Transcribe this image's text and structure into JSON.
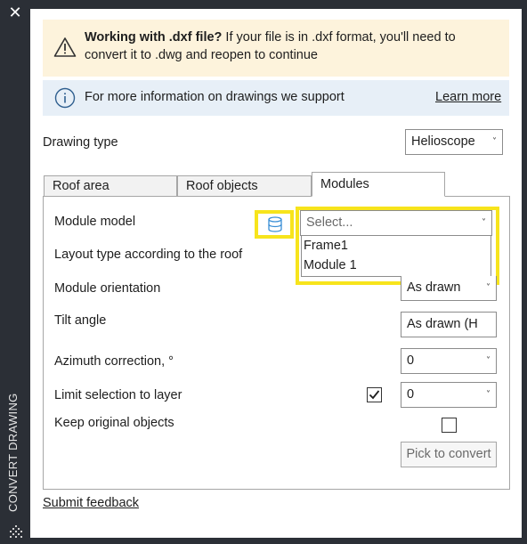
{
  "sidebar": {
    "title": "CONVERT DRAWING",
    "close_icon": "close-icon",
    "grip_icon": "grip-icon"
  },
  "warning": {
    "bold": "Working with .dxf file?",
    "text": " If your file is in .dxf format, you'll need to convert it to .dwg and reopen to continue",
    "icon": "warning-icon",
    "color": "#fdf3dc"
  },
  "info": {
    "text": "For more information on drawings we support",
    "link": "Learn more",
    "icon": "info-icon",
    "color": "#e7eff7"
  },
  "drawing_type": {
    "label": "Drawing type",
    "value": "Helioscope"
  },
  "tabs": [
    {
      "label": "Roof area",
      "active": false
    },
    {
      "label": "Roof objects",
      "active": false
    },
    {
      "label": "Modules",
      "active": true
    }
  ],
  "form": {
    "module_model": {
      "label": "Module model",
      "placeholder": "Select...",
      "options": [
        "Frame1",
        "Module 1"
      ],
      "icon": "database-icon"
    },
    "layout_type": {
      "label": "Layout type according to the roof"
    },
    "module_orientation": {
      "label": "Module orientation",
      "value": "As drawn"
    },
    "tilt_angle": {
      "label": "Tilt angle",
      "value": "As drawn (H"
    },
    "azimuth": {
      "label": "Azimuth correction, °",
      "value": "0"
    },
    "limit_layer": {
      "label": "Limit selection to layer",
      "checked": true,
      "value": "0"
    },
    "keep_original": {
      "label": "Keep original objects",
      "checked": false
    },
    "pick_button": "Pick to convert"
  },
  "footer": {
    "feedback_link": "Submit feedback"
  },
  "highlight_color": "#f7e41c"
}
